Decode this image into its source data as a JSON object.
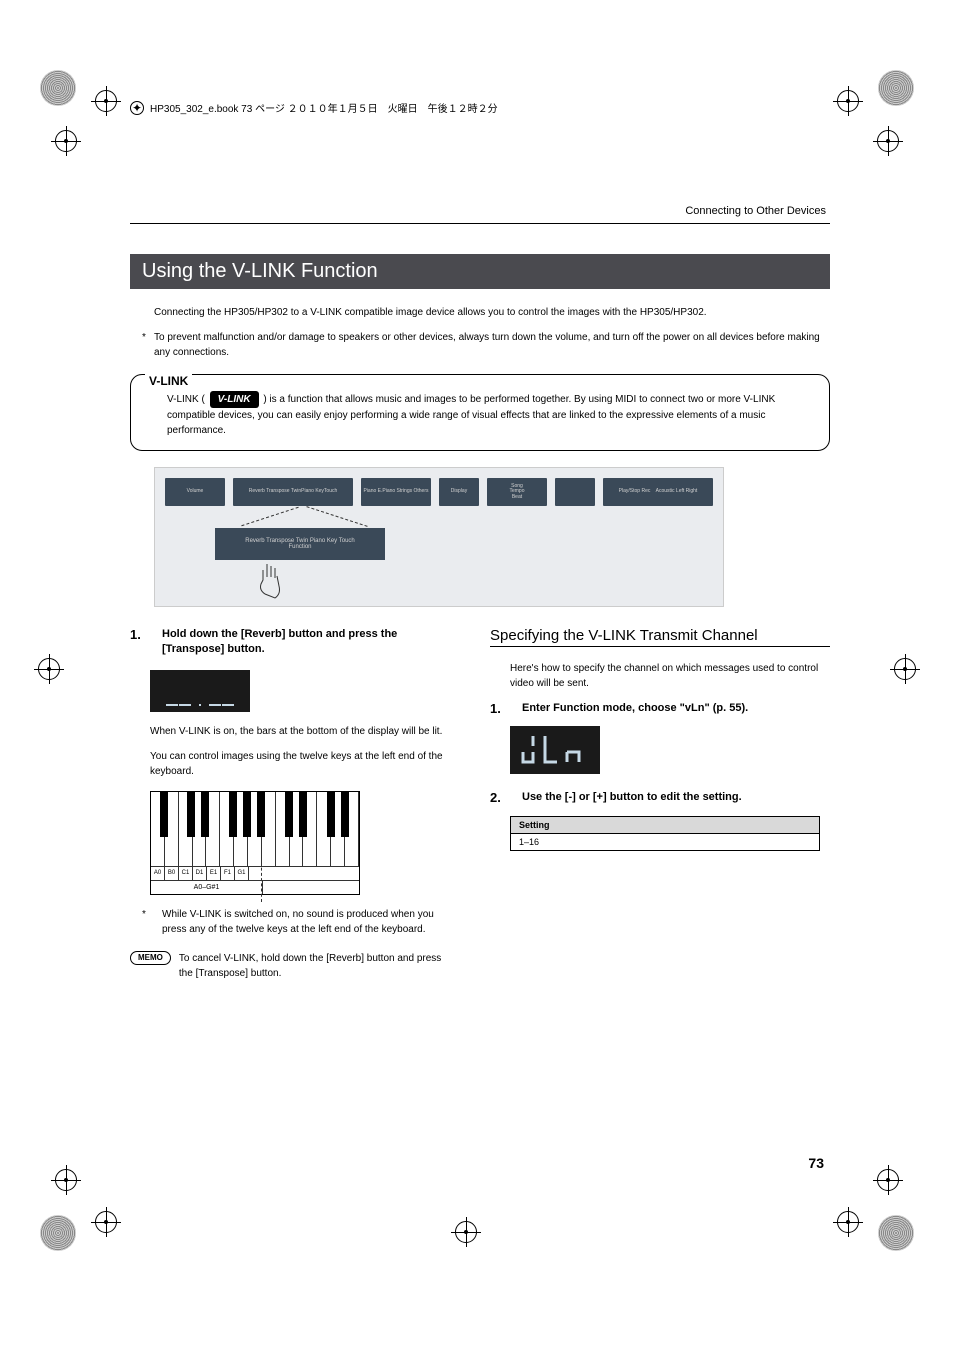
{
  "print_header": "HP305_302_e.book 73 ページ ２０１０年１月５日　火曜日　午後１２時２分",
  "header_label": "Connecting to Other Devices",
  "section_title": "Using the V-LINK Function",
  "intro_text": "Connecting the HP305/HP302 to a V-LINK compatible image device allows you to control the images with the HP305/HP302.",
  "intro_note": "To prevent malfunction and/or damage to speakers or other devices, always turn down the volume, and turn off the power on all devices before making any connections.",
  "vlink": {
    "label": "V-LINK",
    "logo": "V-LINK",
    "pre_text": "V-LINK (",
    "post_text": ") is a function that allows music and images to be performed together. By using MIDI to connect two or more V-LINK compatible devices, you can easily enjoy performing a wide range of visual effects that are linked to the expressive elements of a music performance."
  },
  "panel": {
    "detail_line1": "Reverb   Transpose Twin Piano  Key Touch",
    "detail_line2": "Function"
  },
  "left": {
    "step1_num": "1.",
    "step1_text": "Hold down the [Reverb] button and press the [Transpose] button.",
    "after_display": "When V-LINK is on, the bars at the bottom of the display will be lit.",
    "control_text": "You can control images using the twelve keys at the left end of the keyboard.",
    "key_labels": [
      "A0",
      "B0",
      "C1",
      "D1",
      "E1",
      "F1",
      "G1"
    ],
    "range_label": "A0–G#1",
    "note2": "While V-LINK is switched on, no sound is produced when you press any of the twelve keys at the left end of the keyboard.",
    "memo_label": "MEMO",
    "memo_text": "To cancel V-LINK, hold down the [Reverb] button and press the [Transpose] button."
  },
  "right": {
    "sub_title": "Specifying the V-LINK Transmit Channel",
    "intro": "Here's how to specify the channel on which messages used to control video will be sent.",
    "step1_num": "1.",
    "step1_text": "Enter Function mode, choose \"vLn\" (p. 55).",
    "lcd_text": "uLn",
    "step2_num": "2.",
    "step2_text": "Use the [-] or [+] button to edit the setting.",
    "table_header": "Setting",
    "table_value": "1–16"
  },
  "page_number": "73"
}
